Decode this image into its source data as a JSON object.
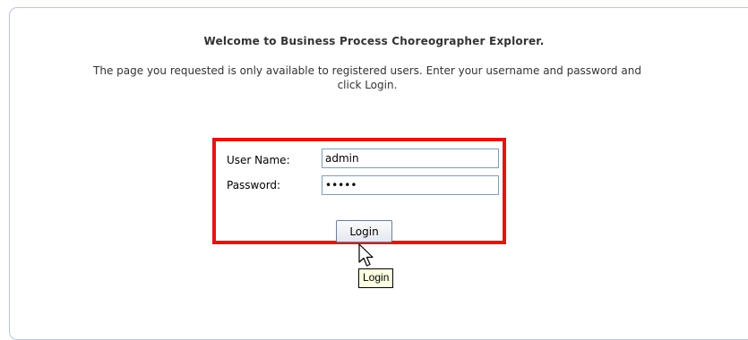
{
  "welcome": {
    "title": "Welcome to Business Process Choreographer Explorer.",
    "message": "The page you requested is only available to registered users. Enter your username and password and click Login."
  },
  "login_form": {
    "username_label": "User Name:",
    "username_value": "admin",
    "password_label": "Password:",
    "password_value": "*****",
    "submit_label": "Login",
    "highlight_color": "#e01616"
  },
  "tooltip": {
    "text": "Login"
  }
}
